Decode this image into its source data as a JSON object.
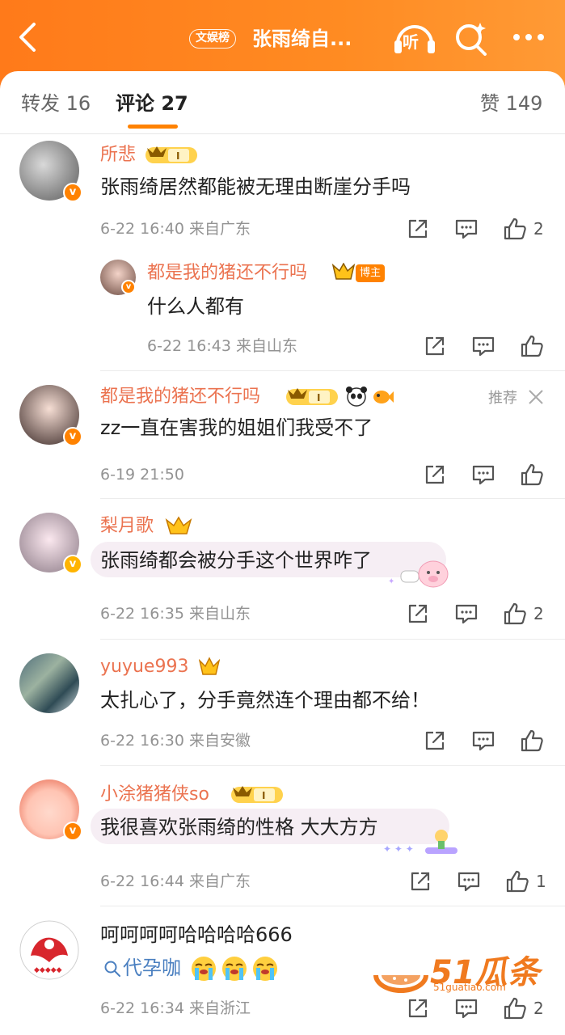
{
  "header": {
    "back_icon": "chevron-left-icon",
    "tag": "文娱榜",
    "title": "张雨绮自...",
    "listen_label": "听",
    "search_icon": "search-sparkle-icon",
    "more_icon": "more-dots-icon",
    "colors": {
      "bar_start": "#ff7a1a",
      "bar_end": "#ff9a35"
    }
  },
  "tabs": {
    "repost": "转发 16",
    "comments": "评论 27",
    "likes": "赞 149"
  },
  "comments": [
    {
      "user": "所悲",
      "text": "张雨绮居然都能被无理由断崖分手吗",
      "meta": "6-22 16:40  来自广东",
      "likes": "2"
    },
    {
      "user": "都是我的猪还不行吗",
      "badge": "博主",
      "text": "什么人都有",
      "meta": "6-22 16:43  来自山东",
      "likes": ""
    },
    {
      "user": "都是我的猪还不行吗",
      "text": "zz一直在害我的姐姐们我受不了",
      "meta": "6-19 21:50",
      "likes": "",
      "recommend": "推荐"
    },
    {
      "user": "梨月歌",
      "text": "张雨绮都会被分手这个世界咋了",
      "meta": "6-22 16:35  来自山东",
      "likes": "2"
    },
    {
      "user": "yuyue993",
      "text": "太扎心了，分手竟然连个理由都不给！",
      "meta": "6-22 16:30  来自安徽",
      "likes": ""
    },
    {
      "user": "小涂猪猪侠so",
      "text": "我很喜欢张雨绮的性格 大大方方",
      "meta": "6-22 16:44  来自广东",
      "likes": "1"
    },
    {
      "user": "",
      "text": "呵呵呵呵哈哈哈哈666",
      "search_link": "代孕咖",
      "meta": "6-22 16:34  来自浙江",
      "likes": "2"
    }
  ],
  "vip_level": "I",
  "watermark": {
    "text": "51瓜条",
    "url": "51guatiao.com"
  },
  "colors": {
    "accent": "#ff8200",
    "username": "#eb7350",
    "meta": "#939393"
  }
}
